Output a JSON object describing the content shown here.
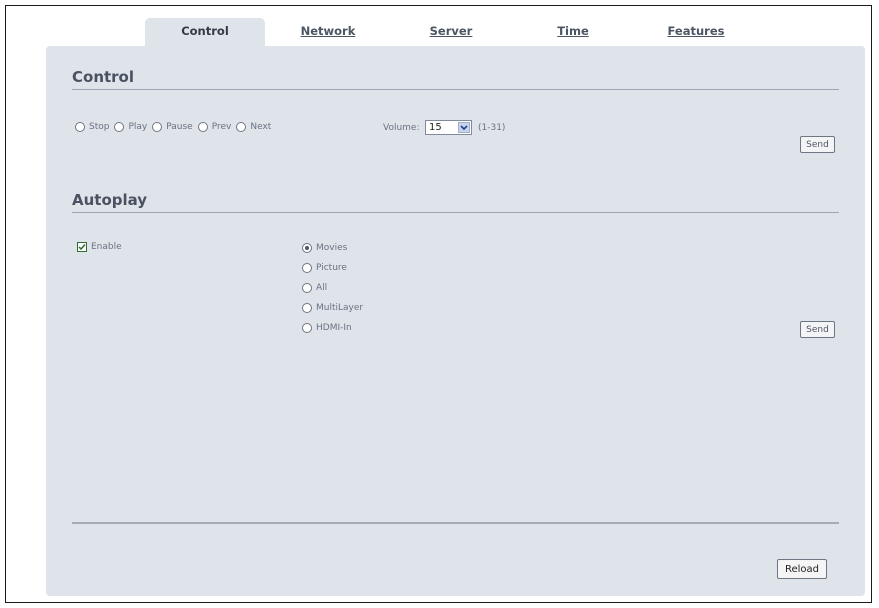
{
  "tabs": [
    {
      "label": "Control",
      "active": true
    },
    {
      "label": "Network",
      "active": false
    },
    {
      "label": "Server",
      "active": false
    },
    {
      "label": "Time",
      "active": false
    },
    {
      "label": "Features",
      "active": false
    }
  ],
  "control": {
    "title": "Control",
    "actions": [
      {
        "label": "Stop",
        "checked": false
      },
      {
        "label": "Play",
        "checked": false
      },
      {
        "label": "Pause",
        "checked": false
      },
      {
        "label": "Prev",
        "checked": false
      },
      {
        "label": "Next",
        "checked": false
      }
    ],
    "volume_label": "Volume:",
    "volume_value": "15",
    "volume_range": "(1-31)",
    "send_label": "Send"
  },
  "autoplay": {
    "title": "Autoplay",
    "enable_label": "Enable",
    "enable_checked": true,
    "options": [
      {
        "label": "Movies",
        "checked": true
      },
      {
        "label": "Picture",
        "checked": false
      },
      {
        "label": "All",
        "checked": false
      },
      {
        "label": "MultiLayer",
        "checked": false
      },
      {
        "label": "HDMI-In",
        "checked": false
      }
    ],
    "send_label": "Send"
  },
  "footer": {
    "reload_label": "Reload"
  },
  "colors": {
    "panel_bg": "#dfe3ea",
    "heading": "#4a5262",
    "check_green": "#2f6e2f"
  },
  "icons": {
    "select_arrow": "chevron-down-icon",
    "checkbox_mark": "checkmark-icon"
  }
}
